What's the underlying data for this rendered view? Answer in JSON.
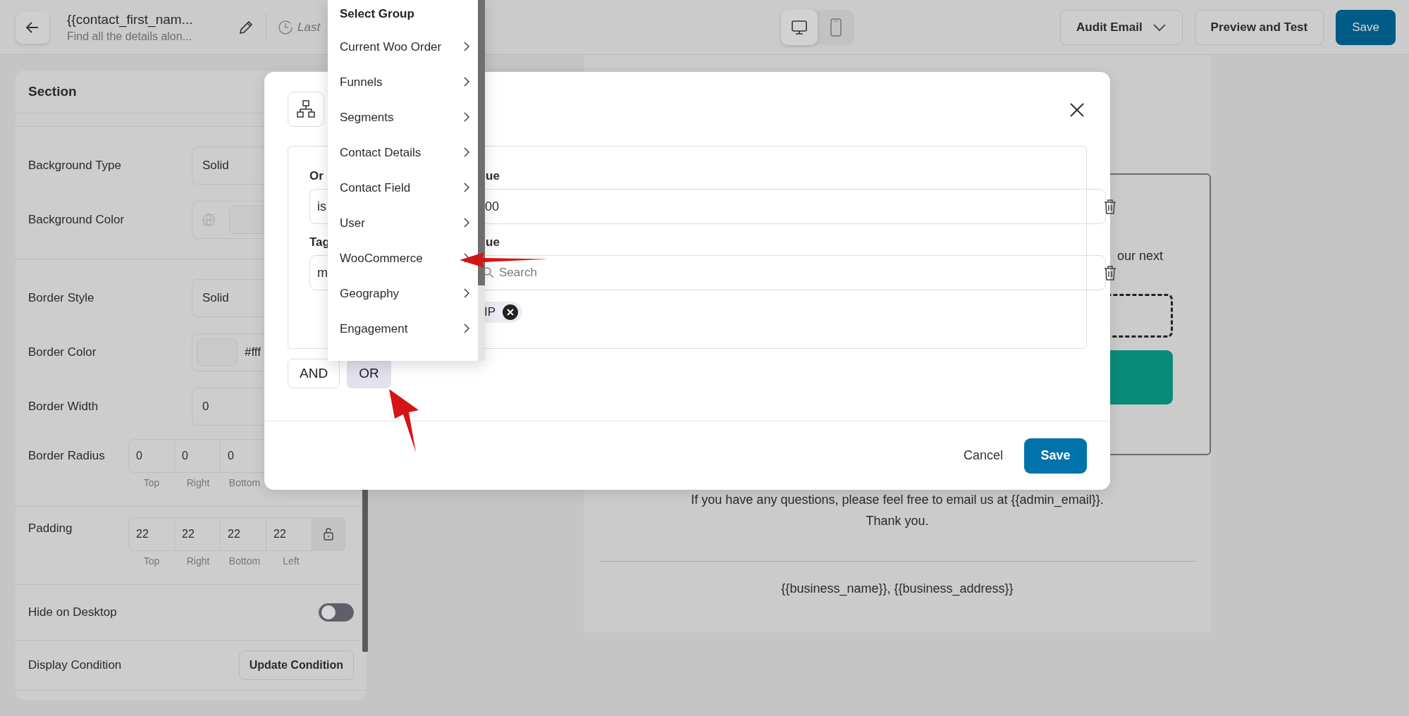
{
  "top_bar": {
    "title": "{{contact_first_nam...",
    "subtitle": "Find all the details alon...",
    "last_saved": "Last",
    "view_modes": [
      {
        "kind": "desktop",
        "selected": true
      },
      {
        "kind": "mobile",
        "selected": false
      }
    ],
    "buttons": [
      {
        "label": "Audit Email",
        "kind": "dropdown"
      },
      {
        "label": "Preview and Test",
        "kind": "secondary"
      },
      {
        "label": "Save",
        "kind": "primary"
      }
    ]
  },
  "panel": {
    "title": "Section",
    "sections": [
      {
        "rows": [
          {
            "kind": "select",
            "label": "Background Type",
            "value": "Solid"
          },
          {
            "kind": "color",
            "label": "Background Color"
          }
        ]
      },
      {
        "rows": [
          {
            "kind": "select",
            "label": "Border Style",
            "value": "Solid"
          },
          {
            "kind": "color",
            "label": "Border Color",
            "value": "#fff"
          },
          {
            "kind": "input",
            "label": "Border Width",
            "value": "0"
          },
          {
            "kind": "sides",
            "label": "Border Radius",
            "values": [
              "0",
              "0",
              "0"
            ],
            "sub_labels": [
              "Top",
              "Right",
              "Bottom"
            ],
            "lock": false
          }
        ]
      },
      {
        "rows": [
          {
            "kind": "sides",
            "label": "Padding",
            "values": [
              "22",
              "22",
              "22",
              "22"
            ],
            "sub_labels": [
              "Top",
              "Right",
              "Bottom",
              "Left"
            ],
            "lock": true
          }
        ]
      },
      {
        "rows": [
          {
            "kind": "toggle",
            "label": "Hide on Desktop",
            "on": false
          }
        ]
      },
      {
        "rows": [
          {
            "kind": "button",
            "label": "Display Condition",
            "button": "Update Condition"
          }
        ]
      }
    ]
  },
  "email": {
    "card_text": "our next",
    "body": [
      "If you have any questions, please feel free to email us at {{admin_email}}.",
      "Thank you."
    ],
    "footer": "{{business_name}}, {{business_address}}"
  },
  "modal": {
    "conditions": [
      {
        "label": "Or",
        "operator": "is",
        "value_label": "ue",
        "value": "00"
      },
      {
        "label": "Tag",
        "operator": "m",
        "value_label": "ue",
        "search_placeholder": "Search",
        "chips": [
          "IP"
        ]
      }
    ],
    "logic_buttons": [
      {
        "label": "AND",
        "selected": false
      },
      {
        "label": "OR",
        "selected": true
      }
    ],
    "cancel": "Cancel",
    "save": "Save"
  },
  "dropdown": {
    "heading": "Select Group",
    "items": [
      "Current Woo Order",
      "Funnels",
      "Segments",
      "Contact Details",
      "Contact Field",
      "User",
      "WooCommerce",
      "Geography",
      "Engagement"
    ]
  }
}
